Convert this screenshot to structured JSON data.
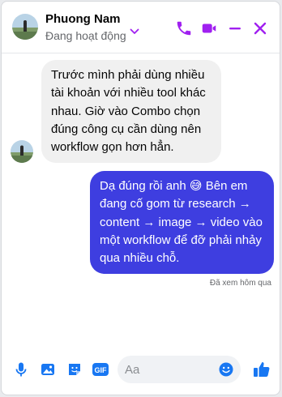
{
  "header": {
    "name": "Phuong Nam",
    "status": "Đang hoạt động"
  },
  "messages": {
    "incoming": "Trước mình phải dùng nhiều tài khoản với nhiều tool khác nhau. Giờ vào Combo chọn đúng công cụ cần dùng nên workflow gọn hơn hẳn.",
    "outgoing": "Dạ đúng rồi anh 😅 Bên em đang cố gom từ research → content → image → video vào một workflow để đỡ phải nhảy qua nhiều chỗ.",
    "seen": "Đã xem hôm qua"
  },
  "composer": {
    "placeholder": "Aa",
    "gif_label": "GIF"
  },
  "colors": {
    "accent": "#a020f0",
    "outgoing_bubble": "#3e3ee0",
    "footer_icon": "#1877f2"
  }
}
